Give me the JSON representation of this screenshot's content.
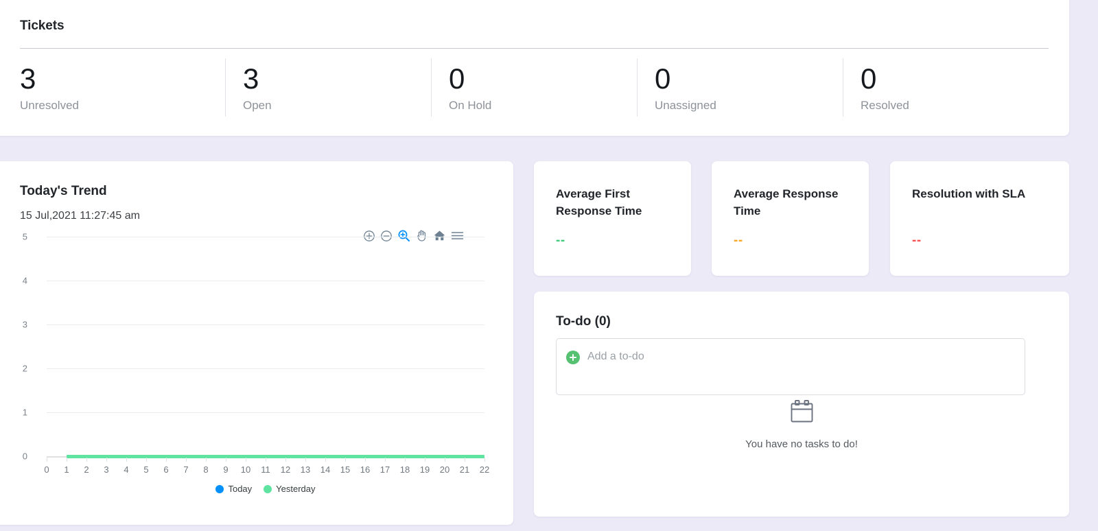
{
  "tickets": {
    "title": "Tickets",
    "stats": [
      {
        "value": "3",
        "label": "Unresolved"
      },
      {
        "value": "3",
        "label": "Open"
      },
      {
        "value": "0",
        "label": "On Hold"
      },
      {
        "value": "0",
        "label": "Unassigned"
      },
      {
        "value": "0",
        "label": "Resolved"
      }
    ]
  },
  "trend": {
    "title": "Today's Trend",
    "date": "15 Jul,2021 11:27:45 am",
    "toolbar": [
      {
        "name": "zoom-in-icon",
        "label": "Zoom In"
      },
      {
        "name": "zoom-out-icon",
        "label": "Zoom Out"
      },
      {
        "name": "selection-zoom-icon",
        "label": "Selection Zoom"
      },
      {
        "name": "pan-icon",
        "label": "Panning"
      },
      {
        "name": "home-icon",
        "label": "Reset Zoom"
      },
      {
        "name": "menu-icon",
        "label": "Menu"
      }
    ]
  },
  "chart_data": {
    "type": "line",
    "title": "Today's Trend",
    "subtitle": "15 Jul,2021 11:27:45 am",
    "xlabel": "",
    "ylabel": "",
    "x": [
      0,
      1,
      2,
      3,
      4,
      5,
      6,
      7,
      8,
      9,
      10,
      11,
      12,
      13,
      14,
      15,
      16,
      17,
      18,
      19,
      20,
      21,
      22
    ],
    "xtick_labels": [
      "0",
      "1",
      "2",
      "3",
      "4",
      "5",
      "6",
      "7",
      "8",
      "9",
      "10",
      "11",
      "12",
      "13",
      "14",
      "15",
      "16",
      "17",
      "18",
      "19",
      "20",
      "21",
      "22"
    ],
    "ytick_labels": [
      "0",
      "1",
      "2",
      "3",
      "4",
      "5"
    ],
    "ylim": [
      0,
      5
    ],
    "xlim": [
      0,
      22
    ],
    "grid": true,
    "legend_position": "bottom",
    "series": [
      {
        "name": "Today",
        "color": "#008FFB",
        "values": [
          0,
          0,
          0,
          0,
          0,
          0,
          0,
          0,
          0,
          0,
          0,
          0,
          0,
          0,
          0,
          0,
          0,
          0,
          0,
          0,
          0,
          0,
          0
        ]
      },
      {
        "name": "Yesterday",
        "color": "#5fe3a1",
        "values": [
          0,
          0,
          0,
          0,
          0,
          0,
          0,
          0,
          0,
          0,
          0,
          0,
          0,
          0,
          0,
          0,
          0,
          0,
          0,
          0,
          0,
          0,
          0
        ]
      }
    ]
  },
  "kpis": [
    {
      "title": "Average First Response Time",
      "value": "--",
      "color": "#3fc97d"
    },
    {
      "title": "Average Response Time",
      "value": "--",
      "color": "#f5a623"
    },
    {
      "title": "Resolution with SLA",
      "value": "--",
      "color": "#f84f4f"
    }
  ],
  "todo": {
    "title": "To-do (0)",
    "add_placeholder": "Add a to-do",
    "empty_icon": "calendar-icon",
    "empty_text": "You have no tasks to do!"
  }
}
